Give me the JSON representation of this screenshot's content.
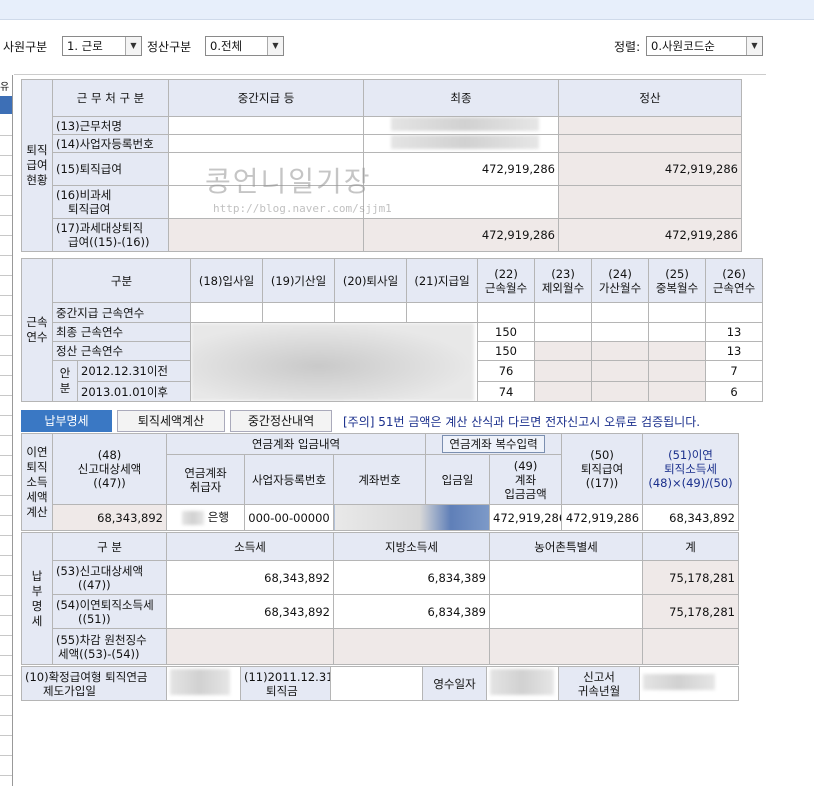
{
  "filters": {
    "emp_type_label": "사원구분",
    "emp_type_value": "1. 근로",
    "settle_type_label": "정산구분",
    "settle_type_value": "0.전체",
    "sort_label": "정렬:",
    "sort_value": "0.사원코드순"
  },
  "left": {
    "stub": "유"
  },
  "sec1": {
    "group_label": "퇴직\n급여\n현황",
    "col_label": "근 무 처 구 분",
    "col_mid": "중간지급 등",
    "col_final": "최종",
    "col_settle": "정산",
    "r13": "(13)근무처명",
    "r14": "(14)사업자등록번호",
    "r15": "(15)퇴직급여",
    "r15_final": "472,919,286",
    "r15_settle": "472,919,286",
    "r16a": "(16)비과세",
    "r16b": "퇴직급여",
    "r17a": "(17)과세대상퇴직",
    "r17b": "급여((15)-(16))",
    "r17_final": "472,919,286",
    "r17_settle": "472,919,286"
  },
  "sec2": {
    "group_label": "근속\n연수",
    "col_gubun": "구분",
    "c18": "(18)입사일",
    "c19": "(19)기산일",
    "c20": "(20)퇴사일",
    "c21": "(21)지급일",
    "c22a": "(22)",
    "c22b": "근속월수",
    "c23a": "(23)",
    "c23b": "제외월수",
    "c24a": "(24)",
    "c24b": "가산월수",
    "c25a": "(25)",
    "c25b": "중복월수",
    "c26a": "(26)",
    "c26b": "근속연수",
    "r_mid": "중간지급 근속연수",
    "r_final": "최종 근속연수",
    "r_settle": "정산 근속연수",
    "anbun": "안\n분",
    "r_pre": "2012.12.31이전",
    "r_post": "2013.01.01이후",
    "final_m": "150",
    "final_y": "13",
    "settle_m": "150",
    "settle_y": "13",
    "pre_m": "76",
    "pre_y": "7",
    "post_m": "74",
    "post_y": "6"
  },
  "tabs": {
    "t1": "납부명세",
    "t2": "퇴직세액계산",
    "t3": "중간정산내역",
    "notice": "[주의] 51번 금액은 계산 산식과 다르면 전자신고시 오류로 검증됩니다."
  },
  "sec3": {
    "group_label": "이연\n퇴직\n소득\n세액\n계산",
    "c48a": "(48)",
    "c48b": "신고대상세액",
    "c48c": "((47))",
    "pension_hdr": "연금계좌 입금내역",
    "multi_btn": "연금계좌 복수입력",
    "c50a": "(50)",
    "c50b": "퇴직급여",
    "c50c": "((17))",
    "c51a": "(51)이연",
    "c51b": "퇴직소득세",
    "c51c": "(48)×(49)/(50)",
    "sub_handler_a": "연금계좌",
    "sub_handler_b": "취급자",
    "sub_bizno": "사업자등록번호",
    "sub_acct": "계좌번호",
    "sub_date": "입금일",
    "c49a": "(49)",
    "c49b": "계좌",
    "c49c": "입금금액",
    "v48": "68,343,892",
    "v_bank": "은행",
    "v_bizno": "000-00-00000",
    "v49": "472,919,286",
    "v50": "472,919,286",
    "v51": "68,343,892"
  },
  "sec4": {
    "group_label": "납\n부\n명\n세",
    "col_gubun": "구 분",
    "col_income": "소득세",
    "col_local": "지방소득세",
    "col_rural": "농어촌특별세",
    "col_total": "계",
    "r53a": "(53)신고대상세액",
    "r53b": "((47))",
    "r53_income": "68,343,892",
    "r53_local": "6,834,389",
    "r53_total": "75,178,281",
    "r54a": "(54)이연퇴직소득세",
    "r54b": "((51))",
    "r54_income": "68,343,892",
    "r54_local": "6,834,389",
    "r54_total": "75,178,281",
    "r55a": "(55)차감 원천징수",
    "r55b": "세액((53)-(54))"
  },
  "bottom": {
    "l10a": "(10)확정급여형 퇴직연금",
    "l10b": "제도가입일",
    "l11a": "(11)2011.12.31",
    "l11b": "퇴직금",
    "receipt": "영수일자",
    "report_a": "신고서",
    "report_b": "귀속년월"
  },
  "watermark": {
    "title": "콩언니일기장",
    "url": "http://blog.naver.com/sjjm1"
  }
}
